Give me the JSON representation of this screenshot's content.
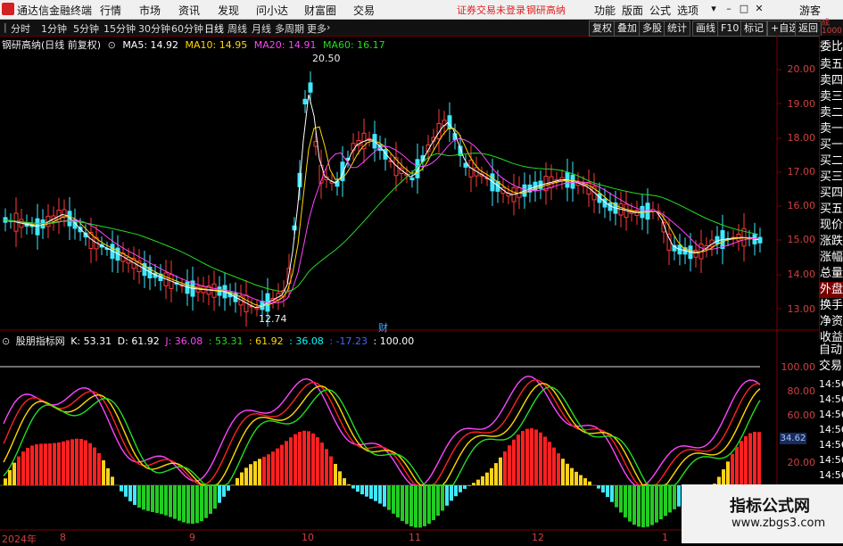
{
  "menubar": {
    "app_title": "通达信金融终端",
    "menus": [
      "行情",
      "市场",
      "资讯",
      "发现",
      "问小达",
      "财富圈",
      "交易"
    ],
    "status": "证券交易未登录",
    "stock": "钢研高纳",
    "right_menus": [
      "功能",
      "版面",
      "公式",
      "选项"
    ],
    "guest": "游客",
    "colors": {
      "status": "#e02020"
    }
  },
  "toolbar": {
    "periods": [
      "分时",
      "1分钟",
      "5分钟",
      "15分钟",
      "30分钟",
      "60分钟",
      "日线",
      "周线",
      "月线",
      "多周期",
      "更多"
    ],
    "active": "日线",
    "right_buttons": [
      "复权",
      "叠加",
      "多股",
      "统计",
      "画线",
      "F10",
      "标记",
      "+自选",
      "返回"
    ]
  },
  "main_chart": {
    "title": "钢研高纳(日线 前复权)",
    "ma": [
      {
        "label": "MA5: 14.92",
        "color": "#ffffff"
      },
      {
        "label": "MA10: 14.95",
        "color": "#ffd700"
      },
      {
        "label": "MA20: 14.91",
        "color": "#ff44ff"
      },
      {
        "label": "MA60: 16.17",
        "color": "#22dd22"
      }
    ],
    "y_ticks": [
      "20.00",
      "19.00",
      "18.00",
      "17.00",
      "16.00",
      "15.00",
      "14.00",
      "13.00"
    ],
    "high_label": "20.50",
    "low_label": "12.74",
    "finance_marker": "财"
  },
  "indicator": {
    "title": "股朋指标网",
    "values": [
      {
        "label": "K: 53.31",
        "color": "#ffffff"
      },
      {
        "label": "D: 61.92",
        "color": "#ffffff"
      },
      {
        "label": "J: 36.08",
        "color": "#ff44ff"
      },
      {
        "label": ": 53.31",
        "color": "#22dd22"
      },
      {
        "label": ": 61.92",
        "color": "#ffd700"
      },
      {
        "label": ": 36.08",
        "color": "#00ffff"
      },
      {
        "label": ": -17.23",
        "color": "#4466ff"
      },
      {
        "label": ": 100.00",
        "color": "#ffffff"
      }
    ],
    "y_ticks": [
      "100.00",
      "80.00",
      "60.00",
      "20.00"
    ],
    "current_tag": "34.62"
  },
  "x_axis": {
    "labels": [
      "2024年",
      "8",
      "9",
      "10",
      "11",
      "12",
      "1"
    ]
  },
  "sidebar": {
    "top_label": "委比",
    "items": [
      "委比",
      "卖五",
      "卖四",
      "卖三",
      "卖二",
      "卖一",
      "买一",
      "买二",
      "买三",
      "买四",
      "买五",
      "现价",
      "涨跌",
      "涨幅",
      "总量",
      "外盘",
      "换手",
      "净资",
      "收益"
    ],
    "selected": "外盘",
    "lower_items": [
      "自动",
      "交易"
    ],
    "small_label": "成",
    "small_value": "1000"
  },
  "time_labels": [
    "14:56",
    "14:56",
    "14:56",
    "14:56",
    "14:56",
    "14:56",
    "14:56"
  ],
  "watermark": {
    "line1": "指标公式网",
    "line2": "www.zbgs3.com"
  }
}
